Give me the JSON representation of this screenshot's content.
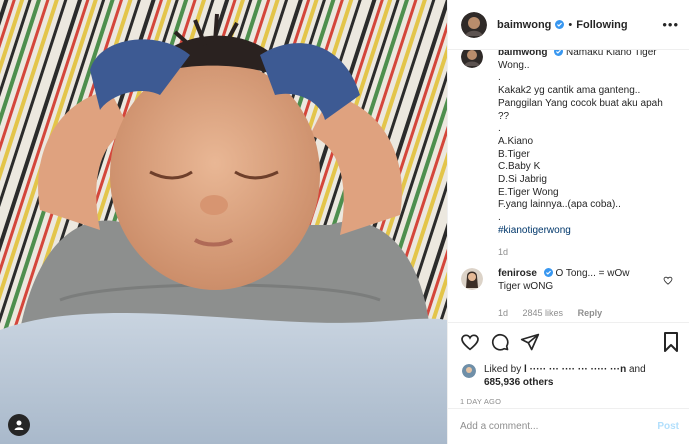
{
  "colors": {
    "text": "#262626",
    "muted": "#8e8e8e",
    "verified": "#3897f0",
    "hashtag": "#00376b",
    "post_disabled": "#b2dffc",
    "border": "#efefef"
  },
  "photo": {
    "subject": "sleeping newborn with mittens, hands on head",
    "overlay_icon": "person-icon"
  },
  "header": {
    "username": "baimwong",
    "verified": true,
    "separator": "•",
    "follow_status": "Following",
    "more_icon": "more-options-icon"
  },
  "caption": {
    "username": "baimwong",
    "lines": [
      "Namaku Kiano Tiger",
      "Wong..",
      ".",
      "Kakak2 yg cantik ama ganteng..",
      "Panggilan Yang cocok buat aku apah",
      "??",
      ".",
      "A.Kiano",
      "B.Tiger",
      "C.Baby K",
      "D.Si Jabrig",
      "E.Tiger Wong",
      "F.yang lainnya..(apa coba)..",
      "."
    ],
    "hashtag": "#kianotigerwong",
    "time": "1d"
  },
  "comment": {
    "username": "fenirose",
    "verified": true,
    "line1": "O Tong... = wOw",
    "line2": "Tiger wONG",
    "time": "1d",
    "likes": "2845 likes",
    "reply": "Reply"
  },
  "actions": {
    "like_icon": "heart-icon",
    "comment_icon": "comment-icon",
    "share_icon": "share-icon",
    "save_icon": "bookmark-icon"
  },
  "likes": {
    "prefix": "Liked by",
    "liker": "l     ·····  ··· ····  ··· ·····  ···n",
    "and": "and",
    "count": "685,936 others"
  },
  "timestamp": "1 DAY AGO",
  "add_comment": {
    "placeholder": "Add a comment...",
    "post_label": "Post"
  }
}
